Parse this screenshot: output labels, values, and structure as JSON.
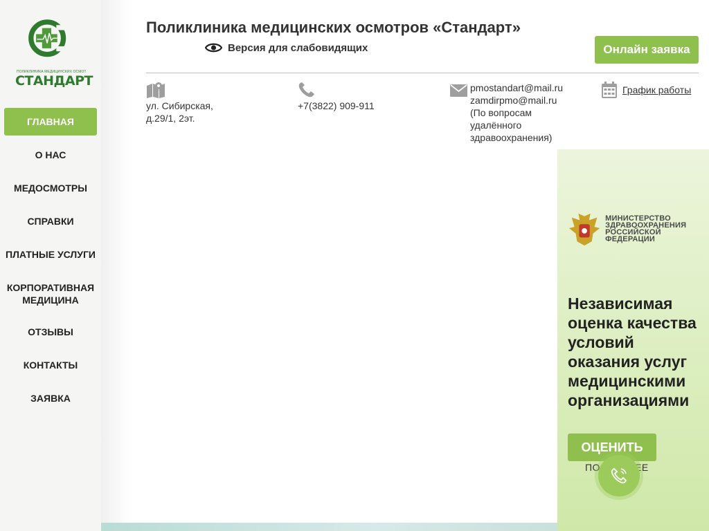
{
  "sidebar": {
    "logo_tagline": "ПОЛИКЛИНИКА МЕДИЦИНСКИХ ОСМОТРОВ",
    "logo_name": "СТАНДАРТ",
    "items": [
      {
        "label": "ГЛАВНАЯ",
        "active": true
      },
      {
        "label": "О НАС"
      },
      {
        "label": "МЕДОСМОТРЫ"
      },
      {
        "label": "СПРАВКИ"
      },
      {
        "label": "ПЛАТНЫЕ УСЛУГИ"
      },
      {
        "label": "КОРПОРАТИВНАЯ МЕДИЦИНА"
      },
      {
        "label": "ОТЗЫВЫ"
      },
      {
        "label": "КОНТАКТЫ"
      },
      {
        "label": "ЗАЯВКА"
      }
    ]
  },
  "header": {
    "title": "Поликлиника медицинских осмотров «Стандарт»",
    "vision_label": "Версия для слабовидящих",
    "online_button": "Онлайн заявка"
  },
  "contacts": {
    "address_line1": "ул. Сибирская,",
    "address_line2": "д.29/1, 2эт.",
    "phone": "+7(3822) 909-911",
    "email1": "pmostandart@mail.ru",
    "email2": "zamdirpmo@mail.ru",
    "email_note1": "(По вопросам",
    "email_note2": "удалённого",
    "email_note3": "здравоохранения)",
    "schedule_link": "График работы"
  },
  "panel": {
    "ministry_line1": "МИНИСТЕРСТВО",
    "ministry_line2": "ЗДРАВООХРАНЕНИЯ",
    "ministry_line3": "РОССИЙСКОЙ ФЕДЕРАЦИИ",
    "heading": "Независимая оценка качества условий оказания услуг медицинскими организациями",
    "rate_button": "ОЦЕНИТЬ",
    "more_link": "ПОДРОБНЕЕ"
  },
  "icons": {
    "map": "map-icon",
    "phone": "phone-icon",
    "email": "envelope-icon",
    "calendar": "calendar-icon",
    "eye": "eye-icon",
    "call": "phone-call-icon"
  },
  "colors": {
    "accent": "#8fc04d",
    "brand_green": "#2f7a2f",
    "icon_gray": "#9e9e9e"
  }
}
